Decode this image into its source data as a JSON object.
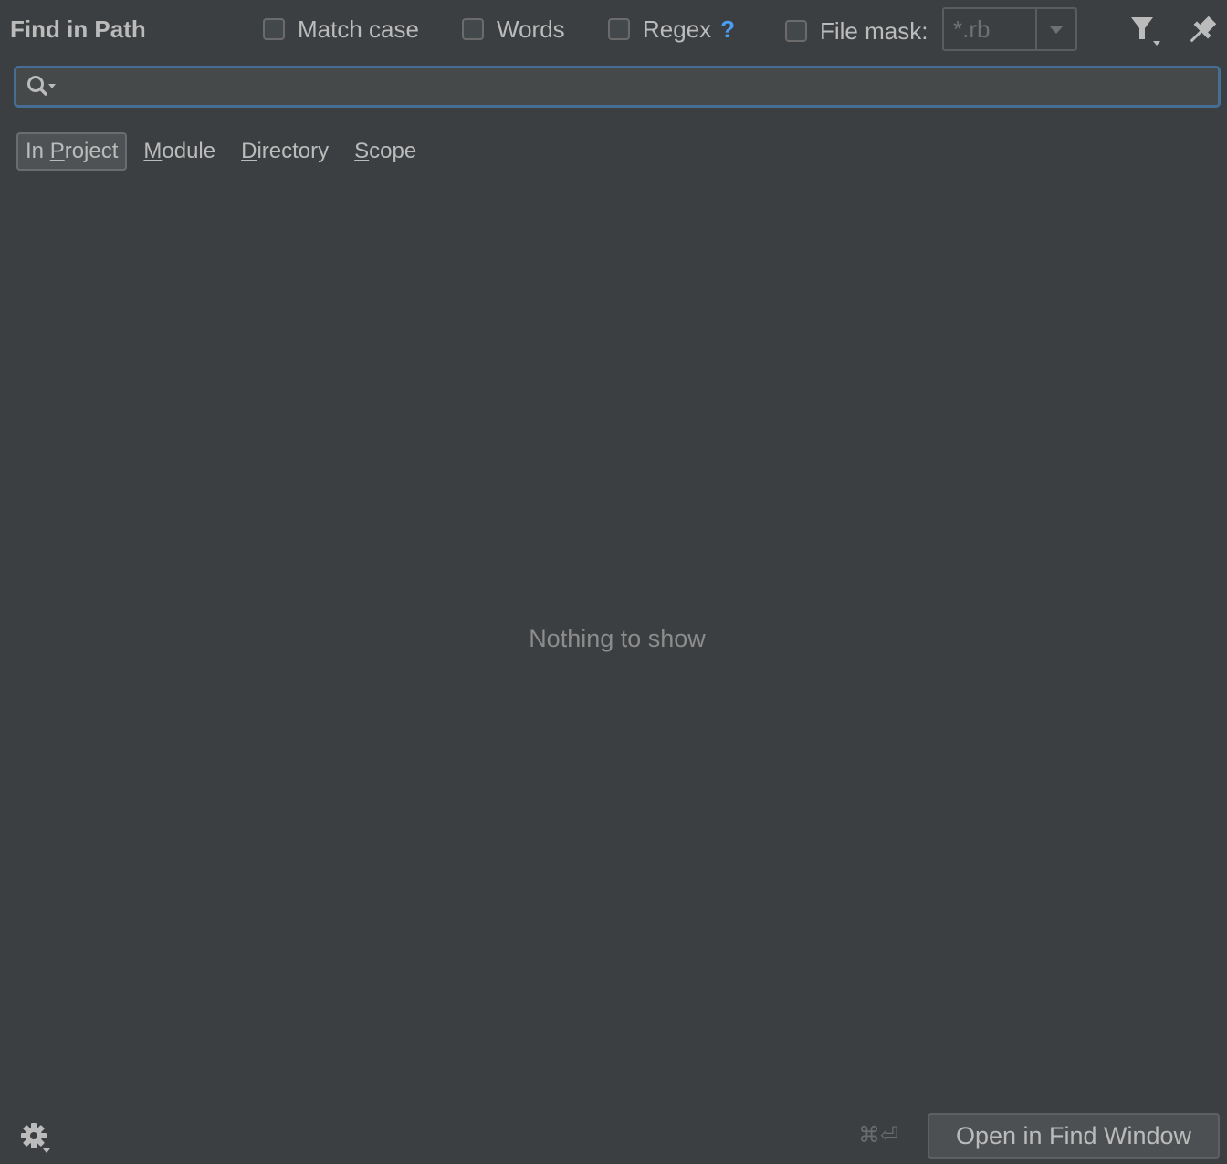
{
  "header": {
    "title": "Find in Path",
    "options": {
      "match_case": {
        "label": "Match case",
        "checked": false
      },
      "words": {
        "label": "Words",
        "checked": false
      },
      "regex": {
        "label": "Regex",
        "help": "?",
        "checked": false
      },
      "file_mask": {
        "label": "File mask:",
        "checked": false
      }
    },
    "file_mask_value": "*.rb",
    "filter_icon": "filter-icon",
    "pin_icon": "pin-icon"
  },
  "search": {
    "icon": "search-icon",
    "value": ""
  },
  "scope_tabs": [
    {
      "pre": "In ",
      "mn": "P",
      "post": "roject",
      "active": true
    },
    {
      "pre": "",
      "mn": "M",
      "post": "odule",
      "active": false
    },
    {
      "pre": "",
      "mn": "D",
      "post": "irectory",
      "active": false
    },
    {
      "pre": "",
      "mn": "S",
      "post": "cope",
      "active": false
    }
  ],
  "results": {
    "empty_text": "Nothing to show"
  },
  "footer": {
    "settings_icon": "gear-icon",
    "shortcut_hint": "⌘⏎",
    "open_button": "Open in Find Window"
  },
  "colors": {
    "background": "#3c3f41",
    "text": "#bbbbbb",
    "focus_border": "#466d94",
    "help_blue": "#4a9ff5",
    "muted": "#8c8c8c"
  }
}
